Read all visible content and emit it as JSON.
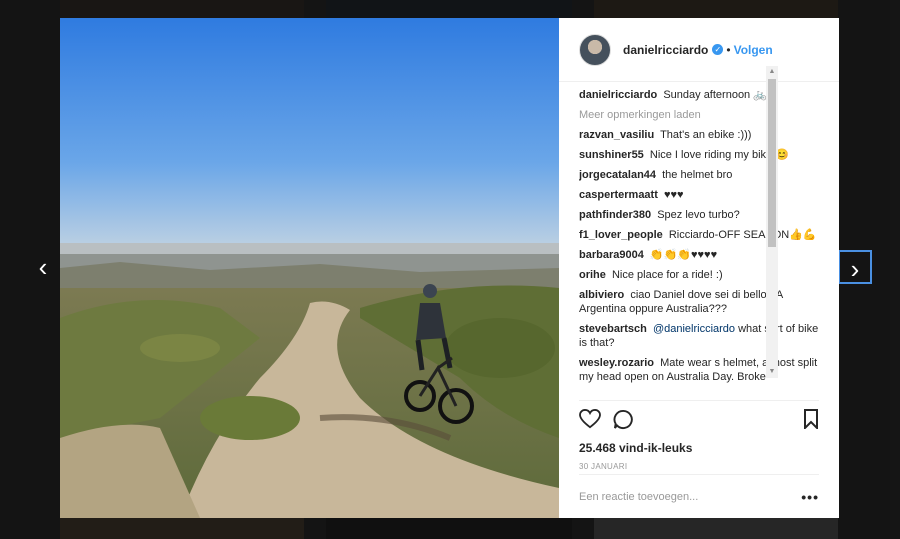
{
  "post": {
    "username": "danielricciardo",
    "follow_label": "Volgen",
    "dot": "•",
    "verified_mark": "✓"
  },
  "caption": {
    "username": "danielricciardo",
    "text": "Sunday afternoon 🚲"
  },
  "load_more": "Meer opmerkingen laden",
  "comments": [
    {
      "user": "razvan_vasiliu",
      "text": "That's an ebike :)))"
    },
    {
      "user": "sunshiner55",
      "text": "Nice I love riding my bike 😊"
    },
    {
      "user": "jorgecatalan44",
      "text": "the helmet bro"
    },
    {
      "user": "caspertermaatt",
      "text": "♥♥♥"
    },
    {
      "user": "pathfinder380",
      "text": "Spez levo turbo?"
    },
    {
      "user": "f1_lover_people",
      "text": "Ricciardo-OFF SEASON👍💪"
    },
    {
      "user": "barbara9004",
      "text": "👏👏👏♥♥♥♥"
    },
    {
      "user": "orihe",
      "text": "Nice place for a ride! :)"
    },
    {
      "user": "albiviero",
      "text": "ciao Daniel dove sei di bello LA Argentina oppure Australia???"
    },
    {
      "user": "stevebartsch",
      "mention": "@danielricciardo",
      "text": " what sort of bike is that?"
    },
    {
      "user": "wesley.rozario",
      "text": "Mate wear s helmet, almost split my head open on Australia Day. Broke"
    }
  ],
  "likes": "25.468 vind-ik-leuks",
  "date": "30 JANUARI",
  "add_comment_placeholder": "Een reactie toevoegen...",
  "more_options": "•••",
  "nav": {
    "prev": "‹",
    "next": "›"
  },
  "scroll": {
    "up": "▲",
    "down": "▼"
  },
  "icons": {
    "like": "heart-outline-icon",
    "comment": "speech-bubble-icon",
    "save": "bookmark-icon",
    "prev": "chevron-left-icon",
    "next": "chevron-right-icon"
  },
  "colors": {
    "link": "#3897f0",
    "text": "#262626",
    "muted": "#999999"
  }
}
